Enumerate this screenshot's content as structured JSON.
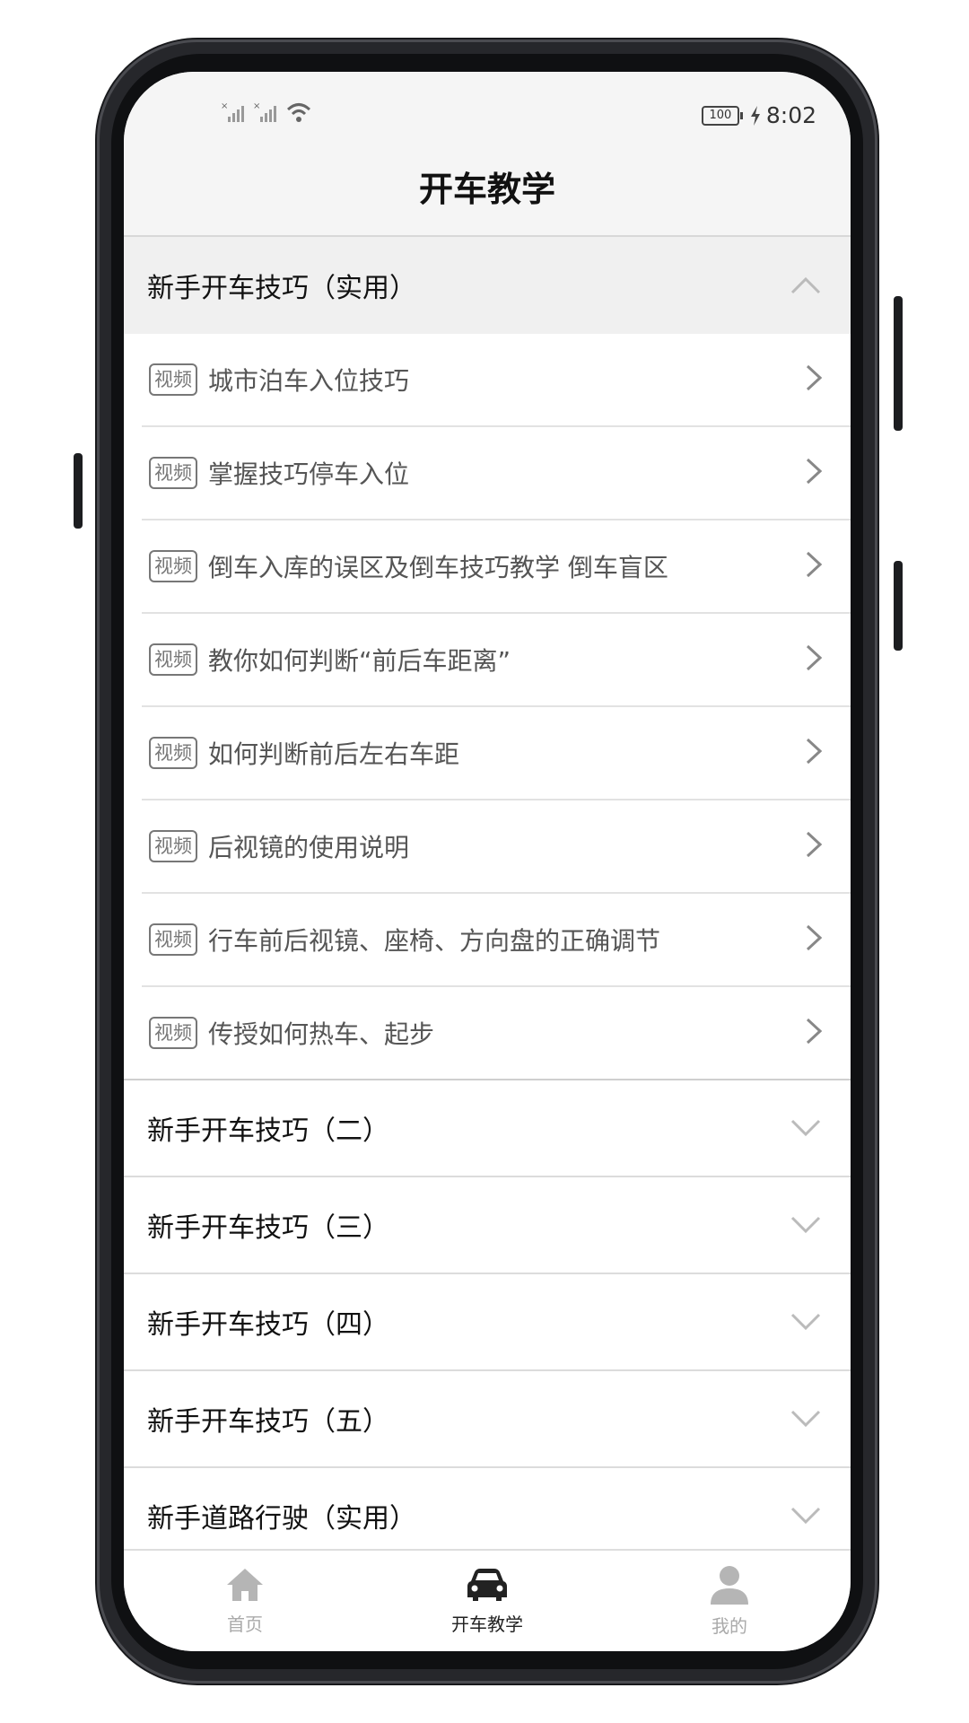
{
  "status": {
    "battery": "100",
    "time": "8:02"
  },
  "header": {
    "title": "开车教学"
  },
  "video_tag": "视频",
  "groups": [
    {
      "title": "新手开车技巧（实用）",
      "expanded": true,
      "items": [
        "城市泊车入位技巧",
        "掌握技巧停车入位",
        "倒车入库的误区及倒车技巧教学 倒车盲区",
        "教你如何判断“前后车距离”",
        "如何判断前后左右车距",
        "后视镜的使用说明",
        "行车前后视镜、座椅、方向盘的正确调节",
        "传授如何热车、起步"
      ]
    },
    {
      "title": "新手开车技巧（二）",
      "expanded": false
    },
    {
      "title": "新手开车技巧（三）",
      "expanded": false
    },
    {
      "title": "新手开车技巧（四）",
      "expanded": false
    },
    {
      "title": "新手开车技巧（五）",
      "expanded": false
    },
    {
      "title": "新手道路行驶（实用）",
      "expanded": false
    }
  ],
  "tabs": [
    {
      "label": "首页",
      "icon": "home-icon",
      "active": false
    },
    {
      "label": "开车教学",
      "icon": "car-icon",
      "active": true
    },
    {
      "label": "我的",
      "icon": "person-icon",
      "active": false
    }
  ],
  "colors": {
    "active_tab": "#222222",
    "inactive_tab": "#aaaaaa",
    "header_bg": "#f5f5f5"
  }
}
